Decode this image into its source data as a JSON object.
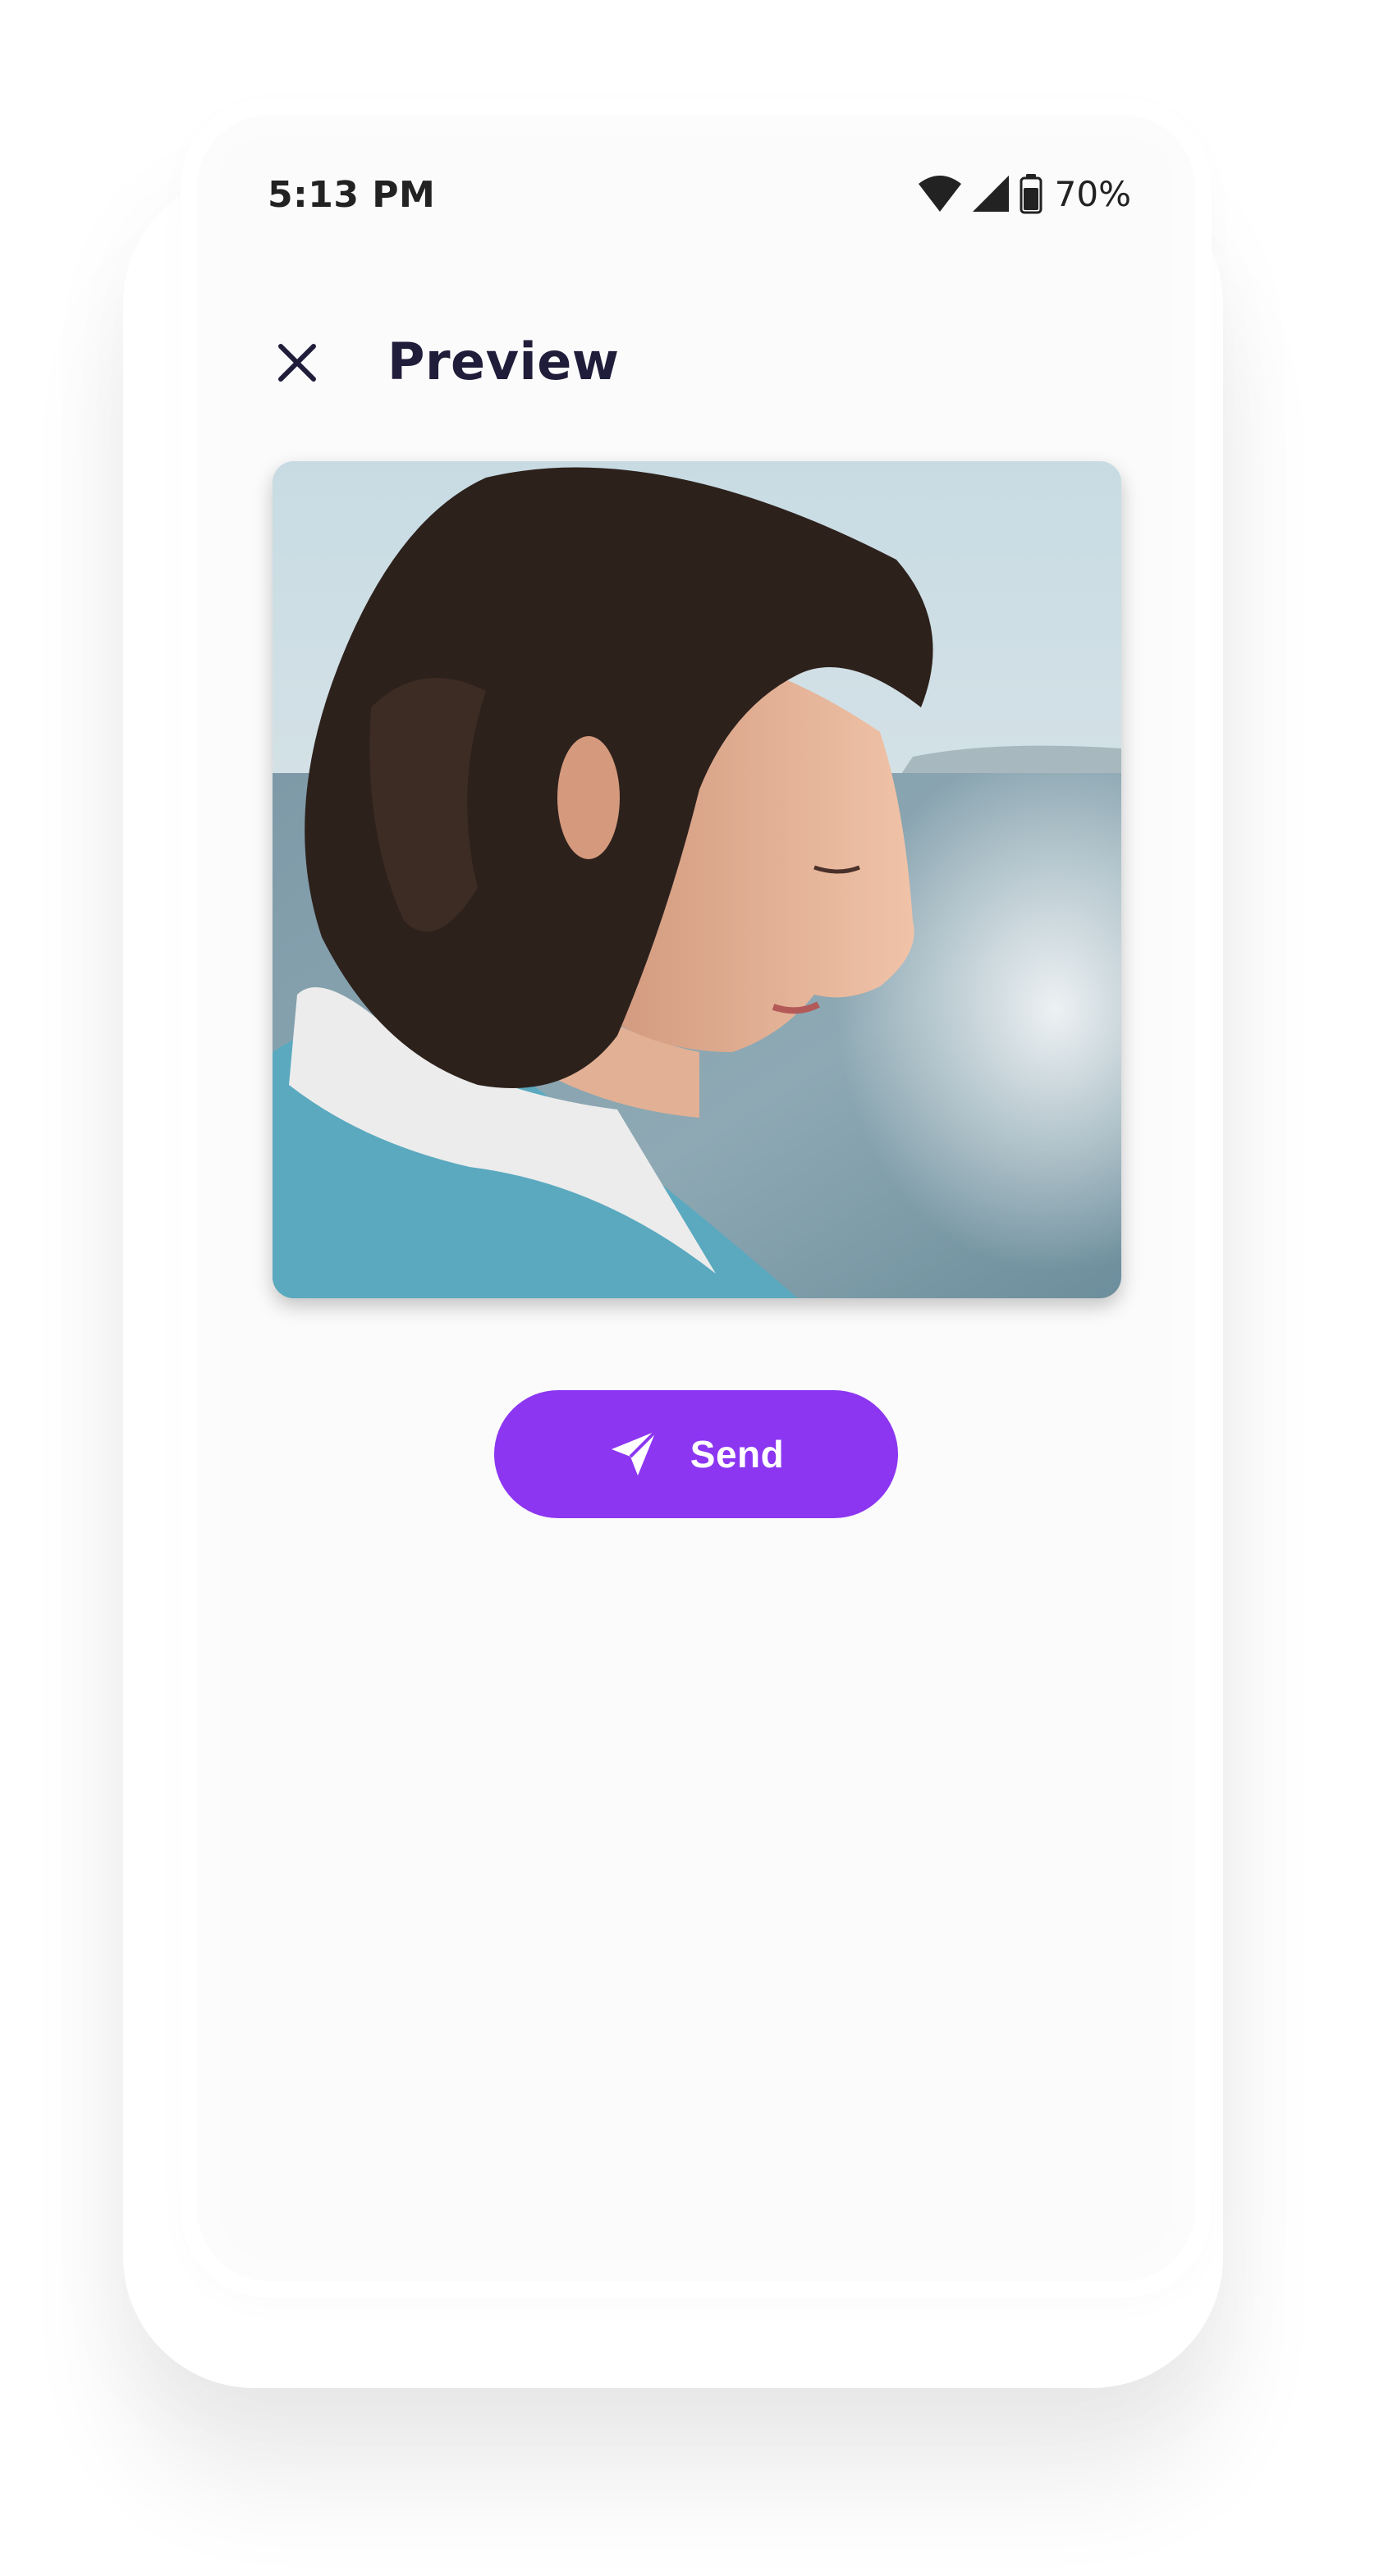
{
  "status_bar": {
    "time": "5:13 PM",
    "battery": "70%",
    "icons": [
      "wifi-icon",
      "cell-signal-icon",
      "battery-icon"
    ]
  },
  "app_bar": {
    "close_icon": "close-icon",
    "title": "Preview"
  },
  "preview": {
    "image": "photo-woman-profile-by-sea"
  },
  "actions": {
    "send_label": "Send",
    "send_icon": "send-icon"
  },
  "colors": {
    "accent": "#8c36f2",
    "title": "#1f1d3a",
    "background": "#fbfbfb"
  }
}
